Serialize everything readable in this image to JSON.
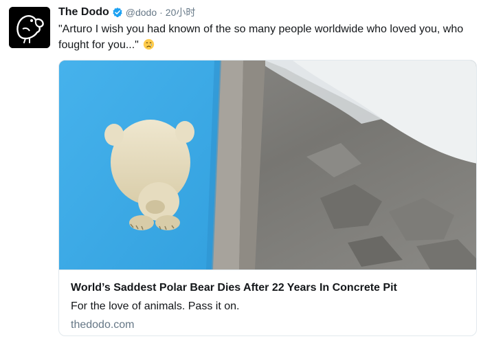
{
  "colors": {
    "verified_badge": "#1da1f2",
    "text_primary": "#14171a",
    "text_secondary": "#657786",
    "pool_blue": "#3fa9e6"
  },
  "tweet": {
    "display_name": "The Dodo",
    "handle": "@dodo",
    "separator": "·",
    "time": "20小时",
    "text": "\"Arturo I wish you had known of the so many people worldwide who loved you, who fought for you...\"",
    "avatar_icon": "dodo-bird-logo-icon",
    "verified_icon": "verified-badge-icon",
    "emoji_icon": "crying-face-emoji-icon"
  },
  "card": {
    "image_description_icon": "polar-bear-photo",
    "title": "World’s Saddest Polar Bear Dies After 22 Years In Concrete Pit",
    "description": "For the love of animals. Pass it on.",
    "domain": "thedodo.com"
  }
}
